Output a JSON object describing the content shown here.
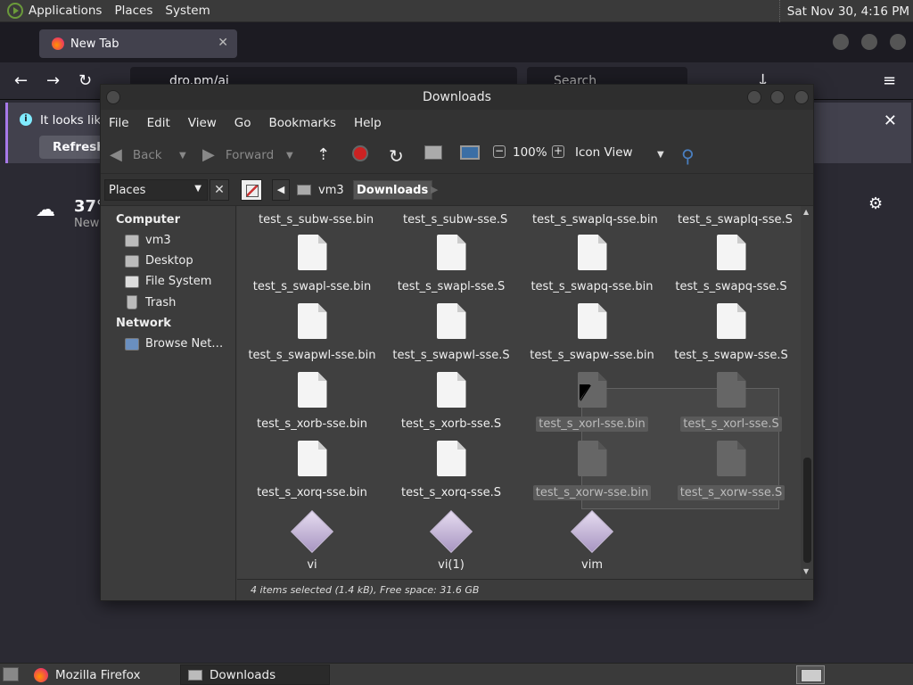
{
  "top_panel": {
    "menus": [
      "Applications",
      "Places",
      "System"
    ],
    "clock": "Sat Nov 30,  4:16 PM"
  },
  "firefox": {
    "tab_title": "New Tab",
    "tab_close": "✕",
    "url_text": "dro.pm/ai",
    "search_placeholder": "Search",
    "notification_text": "It looks like",
    "refresh_button": "Refresh F",
    "close_glyph": "✕",
    "weather_temp": "37°",
    "weather_location": "New"
  },
  "caja": {
    "title": "Downloads",
    "menu": [
      "File",
      "Edit",
      "View",
      "Go",
      "Bookmarks",
      "Help"
    ],
    "toolbar": {
      "back": "Back",
      "forward": "Forward",
      "zoom": "100%",
      "view_mode": "Icon View"
    },
    "location": {
      "places_combo": "Places",
      "close": "✕",
      "crumb_home": "vm3",
      "crumb_current": "Downloads"
    },
    "sidebar": {
      "computer_header": "Computer",
      "computer_items": [
        "vm3",
        "Desktop",
        "File System",
        "Trash"
      ],
      "network_header": "Network",
      "network_items": [
        "Browse Net…"
      ]
    },
    "files": {
      "row0": [
        "test_s_subw-sse.bin",
        "test_s_subw-sse.S",
        "test_s_swaplq-sse.bin",
        "test_s_swaplq-sse.S"
      ],
      "row1": [
        "test_s_swapl-sse.bin",
        "test_s_swapl-sse.S",
        "test_s_swapq-sse.bin",
        "test_s_swapq-sse.S"
      ],
      "row2": [
        "test_s_swapwl-sse.bin",
        "test_s_swapwl-sse.S",
        "test_s_swapw-sse.bin",
        "test_s_swapw-sse.S"
      ],
      "row3": [
        "test_s_xorb-sse.bin",
        "test_s_xorb-sse.S",
        "test_s_xorl-sse.bin",
        "test_s_xorl-sse.S"
      ],
      "row4": [
        "test_s_xorq-sse.bin",
        "test_s_xorq-sse.S",
        "test_s_xorw-sse.bin",
        "test_s_xorw-sse.S"
      ],
      "row5": [
        "vi",
        "vi(1)",
        "vim"
      ]
    },
    "statusbar": "4 items selected (1.4 kB), Free space: 31.6 GB"
  },
  "taskbar": {
    "tasks": [
      "Mozilla Firefox",
      "Downloads"
    ]
  }
}
